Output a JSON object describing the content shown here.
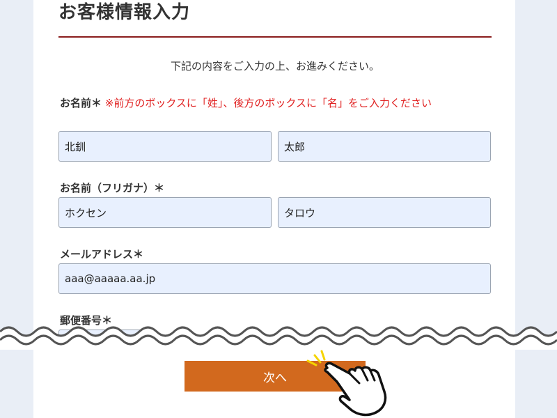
{
  "page": {
    "title": "お客様情報入力",
    "lead": "下記の内容をご入力の上、お進みください。"
  },
  "name": {
    "label": "お名前＊",
    "note": "※前方のボックスに「姓」、後方のボックスに「名」をご入力ください",
    "last_value": "北釧",
    "first_value": "太郎"
  },
  "kana": {
    "label": "お名前（フリガナ）＊",
    "last_value": "ホクセン",
    "first_value": "タロウ"
  },
  "email": {
    "label": "メールアドレス＊",
    "value": "aaa@aaaaa.aa.jp"
  },
  "postal": {
    "label": "郵便番号＊"
  },
  "next_button": {
    "label": "次へ"
  },
  "colors": {
    "accent": "#d2691e",
    "rule": "#8a1c1c",
    "note": "#e02020",
    "field_bg": "#e8f0fe"
  },
  "icons": {
    "pointer": "pointing-hand-icon"
  }
}
